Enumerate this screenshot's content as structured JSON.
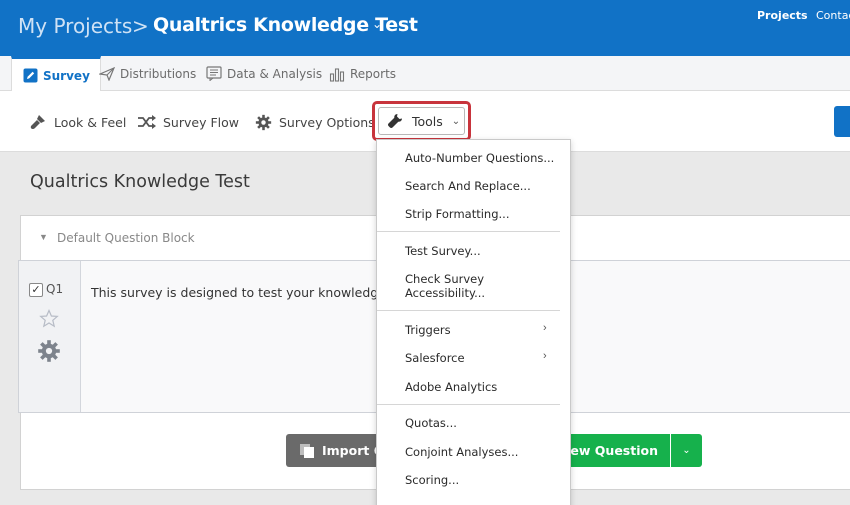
{
  "header": {
    "breadcrumb_root": "My Projects",
    "breadcrumb_separator": ">",
    "project_title": "Qualtrics Knowledge Test",
    "nav_projects": "Projects",
    "nav_contacts": "Contacts"
  },
  "tabs": [
    {
      "label": "Survey",
      "icon": "pencil-icon",
      "active": true
    },
    {
      "label": "Distributions",
      "icon": "paper-plane-icon",
      "active": false
    },
    {
      "label": "Data & Analysis",
      "icon": "document-list-icon",
      "active": false
    },
    {
      "label": "Reports",
      "icon": "bar-chart-icon",
      "active": false
    }
  ],
  "toolbar": {
    "look_feel": "Look & Feel",
    "survey_flow": "Survey Flow",
    "survey_options": "Survey Options",
    "tools": "Tools"
  },
  "survey": {
    "title": "Qualtrics Knowledge Test",
    "block_name": "Default Question Block",
    "question_id": "Q1",
    "question_text": "This survey is designed to test your knowledge o",
    "import_button": "Import Qu",
    "new_question_button": "a New Question"
  },
  "tools_menu": {
    "items": [
      {
        "label": "Auto-Number Questions..."
      },
      {
        "label": "Search And Replace..."
      },
      {
        "label": "Strip Formatting..."
      },
      {
        "label": "Test Survey..."
      },
      {
        "label_line1": "Check Survey",
        "label_line2": "Accessibility..."
      },
      {
        "label": "Triggers",
        "has_submenu": true
      },
      {
        "label": "Salesforce",
        "has_submenu": true
      },
      {
        "label": "Adobe Analytics"
      },
      {
        "label": "Quotas..."
      },
      {
        "label": "Conjoint Analyses..."
      },
      {
        "label": "Scoring..."
      }
    ]
  },
  "colors": {
    "brand_blue": "#1172c6",
    "highlight_red": "#c8343c",
    "green": "#16b14c",
    "import_gray": "#6a6a6a"
  }
}
